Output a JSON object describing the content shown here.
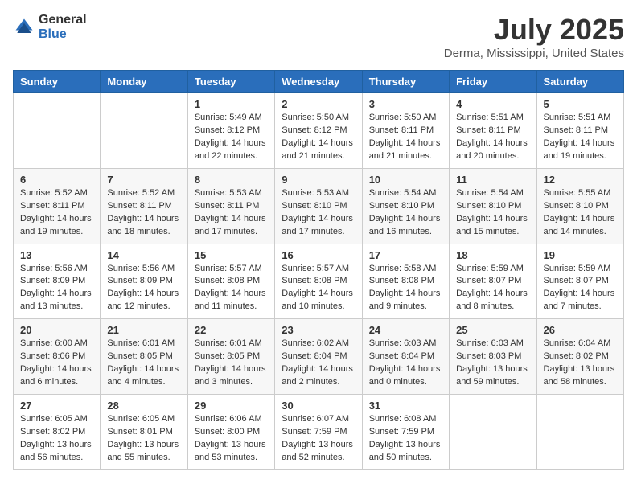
{
  "logo": {
    "general": "General",
    "blue": "Blue"
  },
  "title": "July 2025",
  "location": "Derma, Mississippi, United States",
  "days_of_week": [
    "Sunday",
    "Monday",
    "Tuesday",
    "Wednesday",
    "Thursday",
    "Friday",
    "Saturday"
  ],
  "weeks": [
    [
      {
        "day": "",
        "info": ""
      },
      {
        "day": "",
        "info": ""
      },
      {
        "day": "1",
        "info": "Sunrise: 5:49 AM\nSunset: 8:12 PM\nDaylight: 14 hours and 22 minutes."
      },
      {
        "day": "2",
        "info": "Sunrise: 5:50 AM\nSunset: 8:12 PM\nDaylight: 14 hours and 21 minutes."
      },
      {
        "day": "3",
        "info": "Sunrise: 5:50 AM\nSunset: 8:11 PM\nDaylight: 14 hours and 21 minutes."
      },
      {
        "day": "4",
        "info": "Sunrise: 5:51 AM\nSunset: 8:11 PM\nDaylight: 14 hours and 20 minutes."
      },
      {
        "day": "5",
        "info": "Sunrise: 5:51 AM\nSunset: 8:11 PM\nDaylight: 14 hours and 19 minutes."
      }
    ],
    [
      {
        "day": "6",
        "info": "Sunrise: 5:52 AM\nSunset: 8:11 PM\nDaylight: 14 hours and 19 minutes."
      },
      {
        "day": "7",
        "info": "Sunrise: 5:52 AM\nSunset: 8:11 PM\nDaylight: 14 hours and 18 minutes."
      },
      {
        "day": "8",
        "info": "Sunrise: 5:53 AM\nSunset: 8:11 PM\nDaylight: 14 hours and 17 minutes."
      },
      {
        "day": "9",
        "info": "Sunrise: 5:53 AM\nSunset: 8:10 PM\nDaylight: 14 hours and 17 minutes."
      },
      {
        "day": "10",
        "info": "Sunrise: 5:54 AM\nSunset: 8:10 PM\nDaylight: 14 hours and 16 minutes."
      },
      {
        "day": "11",
        "info": "Sunrise: 5:54 AM\nSunset: 8:10 PM\nDaylight: 14 hours and 15 minutes."
      },
      {
        "day": "12",
        "info": "Sunrise: 5:55 AM\nSunset: 8:10 PM\nDaylight: 14 hours and 14 minutes."
      }
    ],
    [
      {
        "day": "13",
        "info": "Sunrise: 5:56 AM\nSunset: 8:09 PM\nDaylight: 14 hours and 13 minutes."
      },
      {
        "day": "14",
        "info": "Sunrise: 5:56 AM\nSunset: 8:09 PM\nDaylight: 14 hours and 12 minutes."
      },
      {
        "day": "15",
        "info": "Sunrise: 5:57 AM\nSunset: 8:08 PM\nDaylight: 14 hours and 11 minutes."
      },
      {
        "day": "16",
        "info": "Sunrise: 5:57 AM\nSunset: 8:08 PM\nDaylight: 14 hours and 10 minutes."
      },
      {
        "day": "17",
        "info": "Sunrise: 5:58 AM\nSunset: 8:08 PM\nDaylight: 14 hours and 9 minutes."
      },
      {
        "day": "18",
        "info": "Sunrise: 5:59 AM\nSunset: 8:07 PM\nDaylight: 14 hours and 8 minutes."
      },
      {
        "day": "19",
        "info": "Sunrise: 5:59 AM\nSunset: 8:07 PM\nDaylight: 14 hours and 7 minutes."
      }
    ],
    [
      {
        "day": "20",
        "info": "Sunrise: 6:00 AM\nSunset: 8:06 PM\nDaylight: 14 hours and 6 minutes."
      },
      {
        "day": "21",
        "info": "Sunrise: 6:01 AM\nSunset: 8:05 PM\nDaylight: 14 hours and 4 minutes."
      },
      {
        "day": "22",
        "info": "Sunrise: 6:01 AM\nSunset: 8:05 PM\nDaylight: 14 hours and 3 minutes."
      },
      {
        "day": "23",
        "info": "Sunrise: 6:02 AM\nSunset: 8:04 PM\nDaylight: 14 hours and 2 minutes."
      },
      {
        "day": "24",
        "info": "Sunrise: 6:03 AM\nSunset: 8:04 PM\nDaylight: 14 hours and 0 minutes."
      },
      {
        "day": "25",
        "info": "Sunrise: 6:03 AM\nSunset: 8:03 PM\nDaylight: 13 hours and 59 minutes."
      },
      {
        "day": "26",
        "info": "Sunrise: 6:04 AM\nSunset: 8:02 PM\nDaylight: 13 hours and 58 minutes."
      }
    ],
    [
      {
        "day": "27",
        "info": "Sunrise: 6:05 AM\nSunset: 8:02 PM\nDaylight: 13 hours and 56 minutes."
      },
      {
        "day": "28",
        "info": "Sunrise: 6:05 AM\nSunset: 8:01 PM\nDaylight: 13 hours and 55 minutes."
      },
      {
        "day": "29",
        "info": "Sunrise: 6:06 AM\nSunset: 8:00 PM\nDaylight: 13 hours and 53 minutes."
      },
      {
        "day": "30",
        "info": "Sunrise: 6:07 AM\nSunset: 7:59 PM\nDaylight: 13 hours and 52 minutes."
      },
      {
        "day": "31",
        "info": "Sunrise: 6:08 AM\nSunset: 7:59 PM\nDaylight: 13 hours and 50 minutes."
      },
      {
        "day": "",
        "info": ""
      },
      {
        "day": "",
        "info": ""
      }
    ]
  ]
}
